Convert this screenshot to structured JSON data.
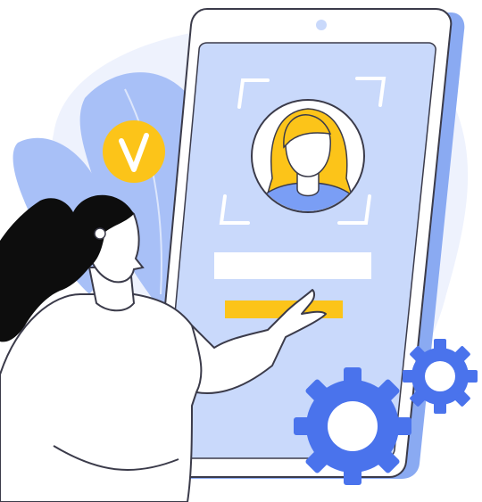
{
  "illustration": {
    "subject": "face-recognition-identity-verification",
    "icons": [
      "tablet-device",
      "user-avatar-icon",
      "face-scan-frame-icon",
      "check-badge-icon",
      "gear-icon"
    ]
  },
  "colors": {
    "background_blob": "#eef2fd",
    "leaf": "#a8c0f7",
    "tablet_body": "#ffffff",
    "tablet_screen": "#c9d9fb",
    "tablet_back": "#8aaaf2",
    "outline": "#3b3b4a",
    "accent_yellow": "#fcc419",
    "gear_blue": "#4a73ec",
    "hair": "#0d0d0d",
    "skin_white": "#ffffff",
    "avatar_shirt": "#7a9ef5"
  }
}
